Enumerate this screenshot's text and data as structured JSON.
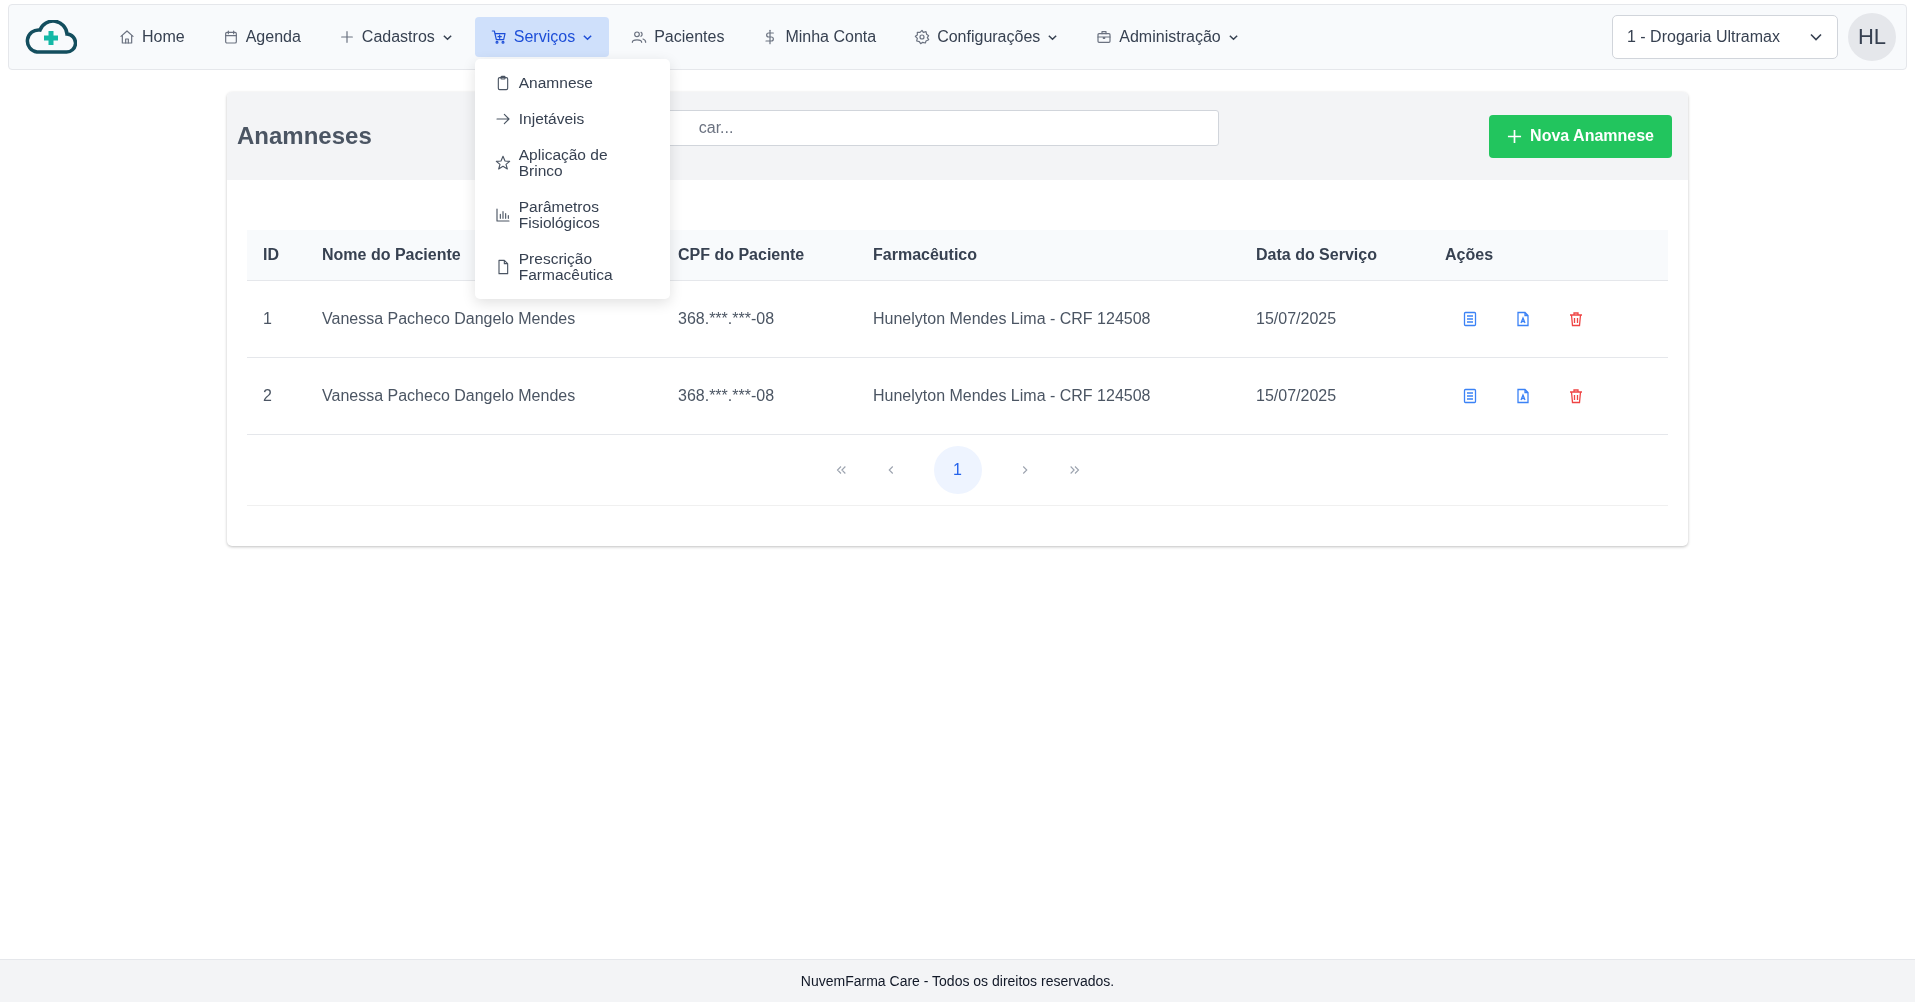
{
  "navbar": {
    "items": [
      {
        "label": "Home",
        "caret": false,
        "selected": false
      },
      {
        "label": "Agenda",
        "caret": false,
        "selected": false
      },
      {
        "label": "Cadastros",
        "caret": true,
        "selected": false
      },
      {
        "label": "Serviços",
        "caret": true,
        "selected": true,
        "menu": [
          {
            "label": "Anamnese"
          },
          {
            "label": "Injetáveis"
          },
          {
            "label": "Aplicação de Brinco"
          },
          {
            "label": "Parâmetros Fisiológicos"
          },
          {
            "label": "Prescrição Farmacêutica"
          }
        ]
      },
      {
        "label": "Pacientes",
        "caret": false,
        "selected": false
      },
      {
        "label": "Minha Conta",
        "caret": false,
        "selected": false
      },
      {
        "label": "Configurações",
        "caret": true,
        "selected": false
      },
      {
        "label": "Administração",
        "caret": true,
        "selected": false
      }
    ],
    "store_select": "1 - Drogaria Ultramax",
    "avatar": "HL"
  },
  "page": {
    "title": "Anamneses",
    "search_placeholder": "car...",
    "new_button": "Nova Anamnese"
  },
  "table": {
    "columns": [
      "ID",
      "Nome do Paciente",
      "CPF do Paciente",
      "Farmacêutico",
      "Data do Serviço",
      "Ações"
    ],
    "rows": [
      {
        "cells": [
          "1",
          "Vanessa Pacheco Dangelo Mendes",
          "368.***.***-08",
          "Hunelyton Mendes Lima - CRF 124508",
          "15/07/2025"
        ]
      },
      {
        "cells": [
          "2",
          "Vanessa Pacheco Dangelo Mendes",
          "368.***.***-08",
          "Hunelyton Mendes Lima - CRF 124508",
          "15/07/2025"
        ]
      }
    ]
  },
  "pagination": {
    "pages": [
      {
        "label": "1",
        "selected": true
      }
    ]
  },
  "footer": "NuvemFarma Care - Todos os direitos reservados."
}
